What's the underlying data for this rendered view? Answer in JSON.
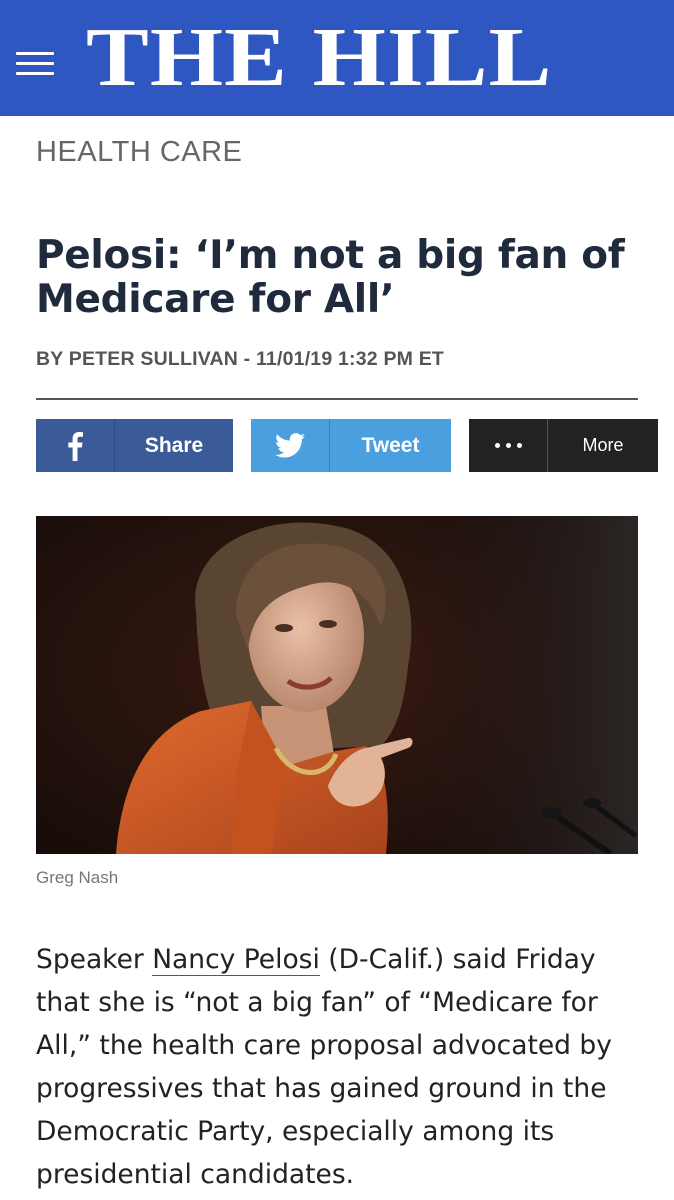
{
  "header": {
    "logo": "THE HILL",
    "bg_color": "#2f57c1"
  },
  "article": {
    "section": "HEALTH CARE",
    "headline": "Pelosi: ‘I’m not a big fan of Medicare for All’",
    "byline": "BY PETER SULLIVAN - 11/01/19 1:32 PM ET",
    "photo_credit": "Greg Nash",
    "body_pre": "Speaker ",
    "body_link": "Nancy Pelosi",
    "body_post": " (D-Calif.) said Friday that she is “not a big fan” of “Medicare for All,” the health care proposal  advocated by progressives that has gained ground in the Democratic Party, especially among its presidential candidates."
  },
  "share": {
    "facebook": {
      "label": "Share",
      "icon": "facebook-icon",
      "color": "#3b5a98"
    },
    "twitter": {
      "label": "Tweet",
      "icon": "twitter-bird-icon",
      "color": "#4a9fdf"
    },
    "more": {
      "label": "More",
      "icon": "ellipsis-icon",
      "color": "#222222"
    }
  }
}
